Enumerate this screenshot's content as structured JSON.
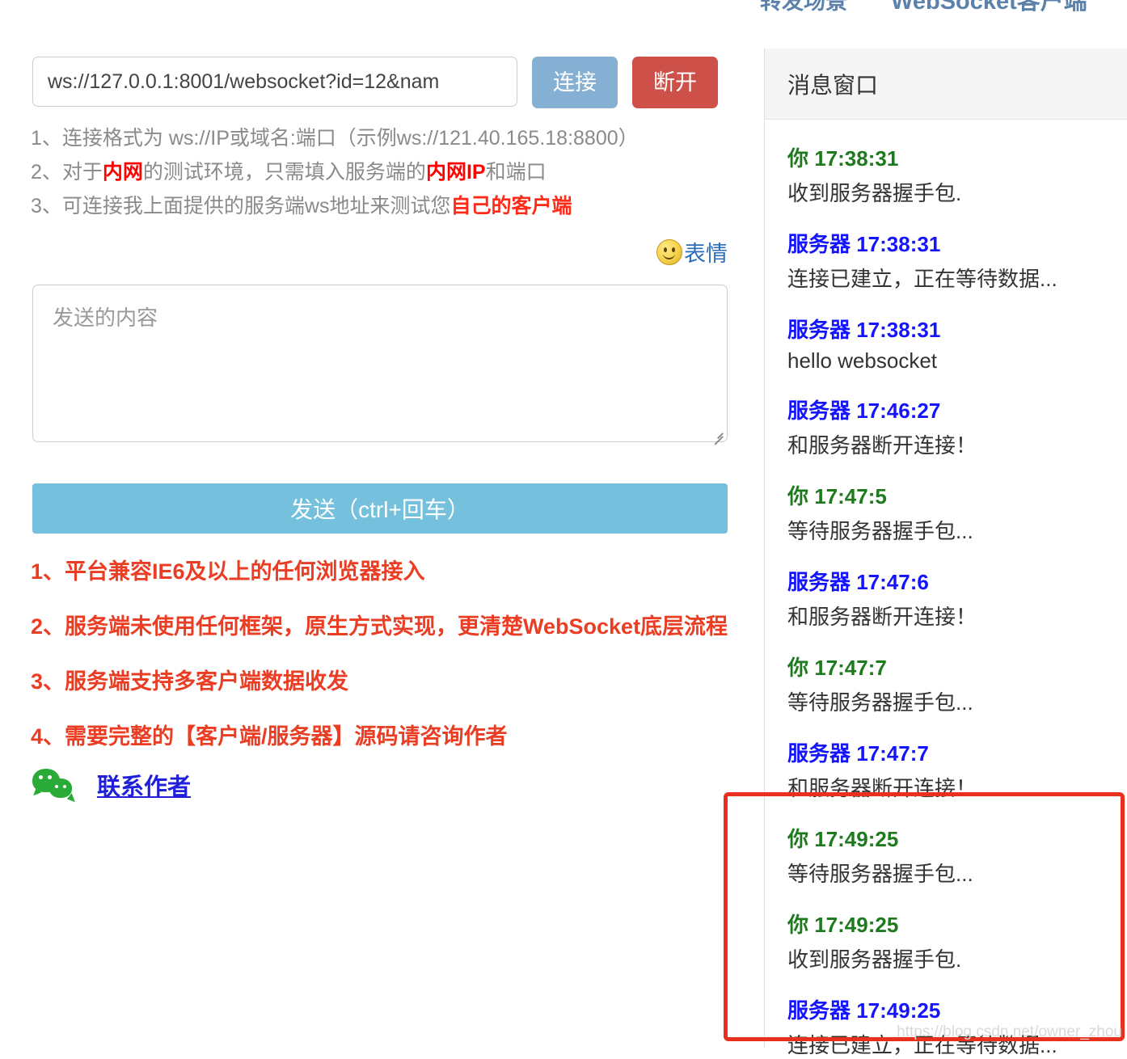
{
  "top_nav": {
    "item1": "转发场景",
    "item2": "WebSocket客户端"
  },
  "connection": {
    "url_value": "ws://127.0.0.1:8001/websocket?id=12&nam",
    "url_placeholder": "ws://IP或域名:端口",
    "connect_label": "连接",
    "disconnect_label": "断开"
  },
  "tips": {
    "line1_a": "1、连接格式为 ws://IP或域名:端口（示例ws://121.40.165.18:8800）",
    "line2_a": "2、对于",
    "line2_hl1": "内网",
    "line2_b": "的测试环境，只需填入服务端的",
    "line2_hl2": "内网IP",
    "line2_c": "和端口",
    "line3_a": "3、可连接我上面提供的服务端ws地址来测试您",
    "line3_hl": "自己的客户端"
  },
  "emoji": {
    "label": "表情",
    "icon": "smiley-icon"
  },
  "compose": {
    "placeholder": "发送的内容",
    "value": "",
    "send_label": "发送（ctrl+回车）"
  },
  "features": [
    "1、平台兼容IE6及以上的任何浏览器接入",
    "2、服务端未使用任何框架，原生方式实现，更清楚WebSocket底层流程",
    "3、服务端支持多客户端数据收发",
    "4、需要完整的【客户端/服务器】源码请咨询作者"
  ],
  "contact": {
    "icon": "wechat-icon",
    "label": "联系作者"
  },
  "messages_panel": {
    "title": "消息窗口",
    "messages": [
      {
        "sender": "你",
        "time": "17:38:31",
        "role": "you",
        "text": "收到服务器握手包."
      },
      {
        "sender": "服务器",
        "time": "17:38:31",
        "role": "server",
        "text": "连接已建立，正在等待数据..."
      },
      {
        "sender": "服务器",
        "time": "17:38:31",
        "role": "server",
        "text": "hello websocket"
      },
      {
        "sender": "服务器",
        "time": "17:46:27",
        "role": "server",
        "text": "和服务器断开连接！"
      },
      {
        "sender": "你",
        "time": "17:47:5",
        "role": "you",
        "text": "等待服务器握手包..."
      },
      {
        "sender": "服务器",
        "time": "17:47:6",
        "role": "server",
        "text": "和服务器断开连接！"
      },
      {
        "sender": "你",
        "time": "17:47:7",
        "role": "you",
        "text": "等待服务器握手包..."
      },
      {
        "sender": "服务器",
        "time": "17:47:7",
        "role": "server",
        "text": "和服务器断开连接！"
      },
      {
        "sender": "你",
        "time": "17:49:25",
        "role": "you",
        "text": "等待服务器握手包..."
      },
      {
        "sender": "你",
        "time": "17:49:25",
        "role": "you",
        "text": "收到服务器握手包."
      },
      {
        "sender": "服务器",
        "time": "17:49:25",
        "role": "server",
        "text": "连接已建立，正在等待数据..."
      }
    ]
  },
  "annotation": {
    "color": "#e8301c"
  },
  "watermark": "https://blog.csdn.net/owner_zhou",
  "colors": {
    "connect_button": "#85b0d4",
    "disconnect_button": "#cd5049",
    "send_button": "#74c0dd",
    "you_label": "#1d7a1d",
    "server_label": "#1414ff",
    "feature_text": "#ea3d23",
    "highlight_red": "#ff0000",
    "link_blue": "#2020d8"
  }
}
